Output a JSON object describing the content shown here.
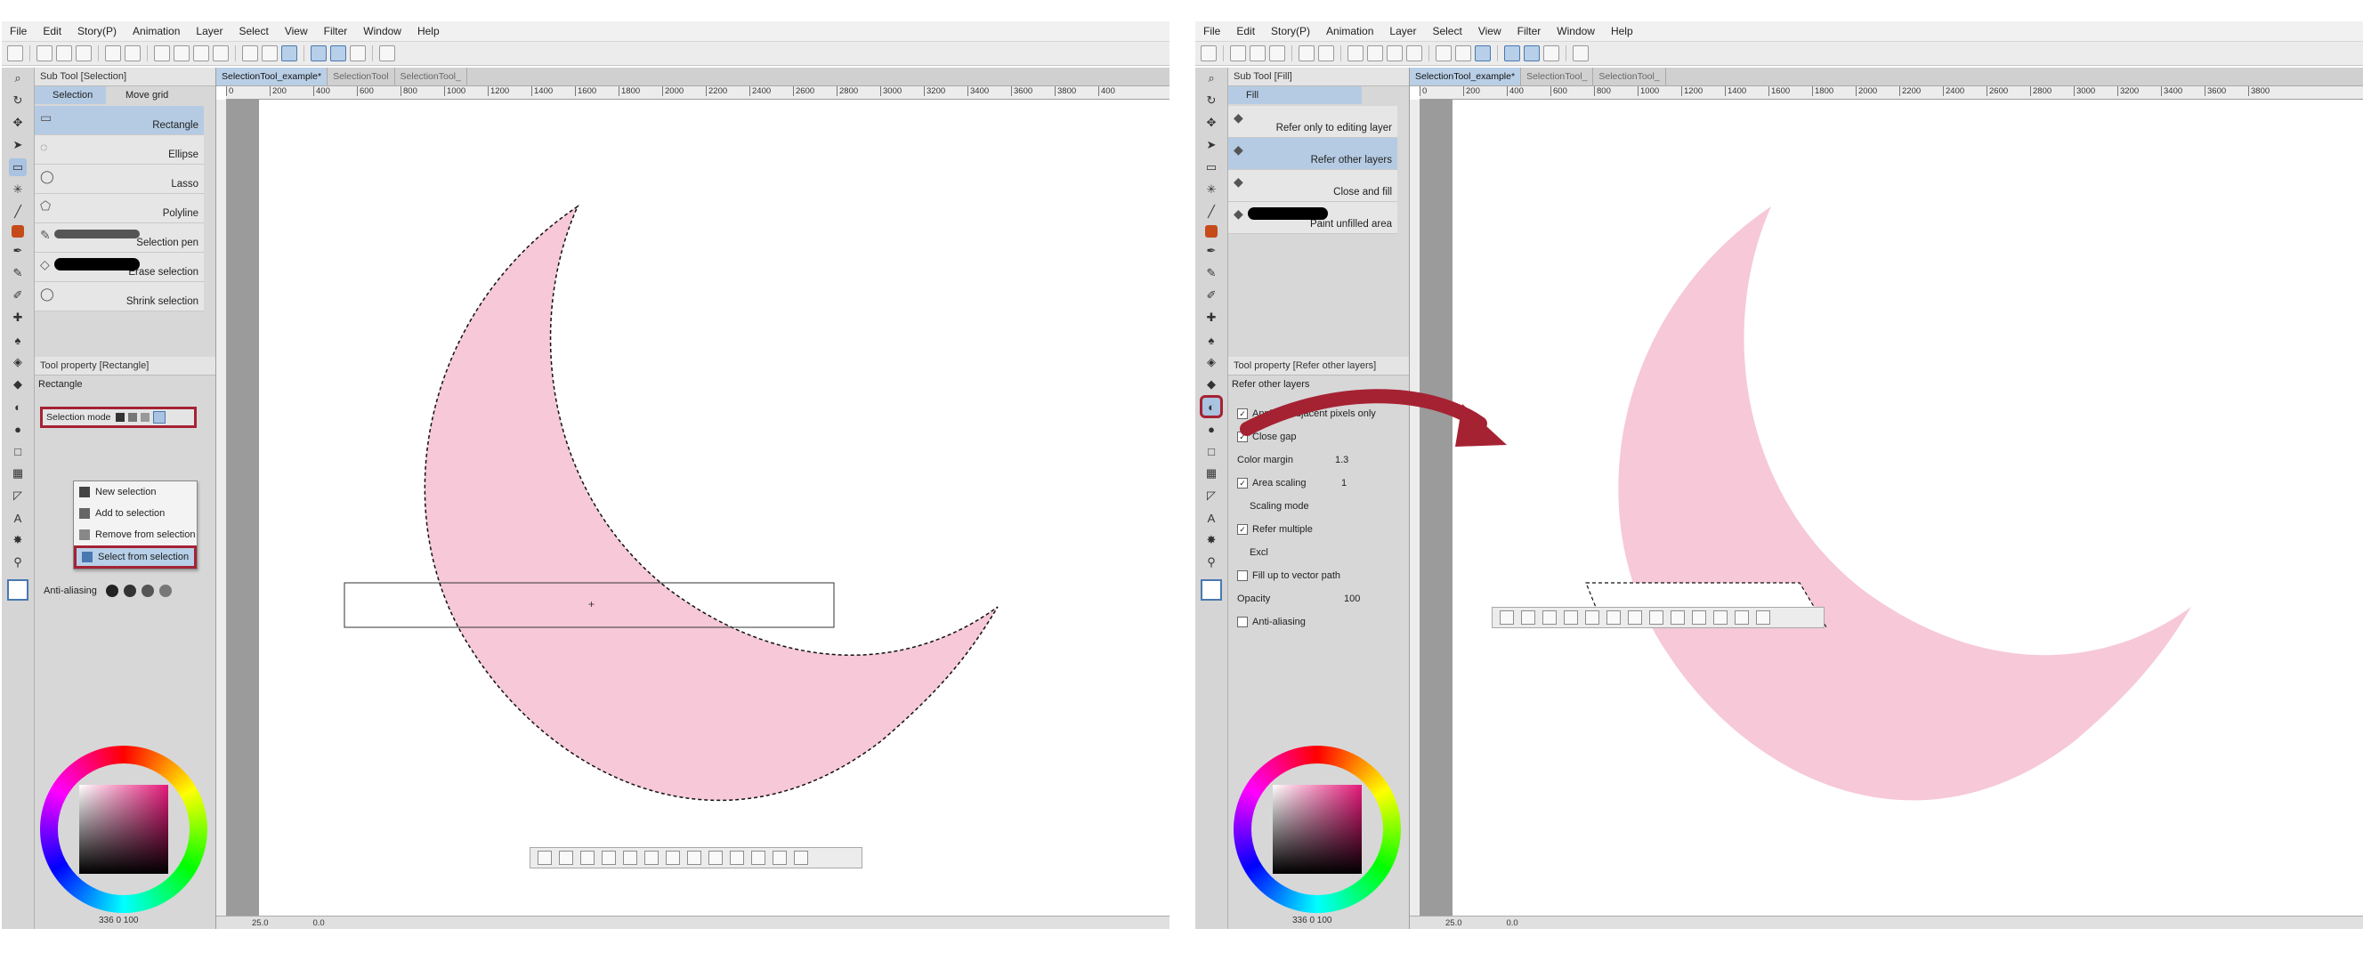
{
  "menu": [
    "File",
    "Edit",
    "Story(P)",
    "Animation",
    "Layer",
    "Select",
    "View",
    "Filter",
    "Window",
    "Help"
  ],
  "accent": "#a52233",
  "moon_color": "#f6c8d8",
  "left": {
    "subtool_panel_title": "Sub Tool [Selection]",
    "subtool_tabs": [
      "Selection",
      "Move grid"
    ],
    "subtools": [
      "Rectangle",
      "Ellipse",
      "Lasso",
      "Polyline",
      "Selection pen",
      "Erase selection",
      "Shrink selection"
    ],
    "tool_property_title": "Tool property [Rectangle]",
    "tool_property_name": "Rectangle",
    "selection_mode_label": "Selection mode",
    "selection_modes": [
      "New selection",
      "Add to selection",
      "Remove from selection",
      "Select from selection"
    ],
    "anti_aliasing_label": "Anti-aliasing",
    "tabs": [
      "SelectionTool_example*",
      "SelectionTool",
      "SelectionTool_"
    ],
    "ruler_ticks": [
      "0",
      "200",
      "400",
      "600",
      "800",
      "1000",
      "1200",
      "1400",
      "1600",
      "1800",
      "2000",
      "2200",
      "2400",
      "2600",
      "2800",
      "3000",
      "3200",
      "3400",
      "3600",
      "3800",
      "400"
    ],
    "zoom": "25.0",
    "angle": "0.0",
    "status": "336  0  100"
  },
  "right": {
    "subtool_panel_title": "Sub Tool [Fill]",
    "subtools": [
      "Fill",
      "Refer only to editing layer",
      "Refer other layers",
      "Close and fill",
      "Paint unfilled area"
    ],
    "tool_property_title": "Tool property [Refer other layers]",
    "tool_property_name": "Refer other layers",
    "props": {
      "apply_adjacent": "Apply to adjacent pixels only",
      "close_gap": "Close gap",
      "color_margin": "Color margin",
      "color_margin_value": "1.3",
      "area_scaling": "Area scaling",
      "area_scaling_value": "1",
      "scaling_mode": "Scaling mode",
      "refer_multiple": "Refer multiple",
      "exclude": "Excl",
      "fill_vector": "Fill up to vector path",
      "opacity": "Opacity",
      "opacity_value": "100",
      "anti_aliasing": "Anti-aliasing"
    },
    "tabs": [
      "SelectionTool_example*",
      "SelectionTool_",
      "SelectionTool_"
    ],
    "ruler_ticks": [
      "0",
      "200",
      "400",
      "600",
      "800",
      "1000",
      "1200",
      "1400",
      "1600",
      "1800",
      "2000",
      "2200",
      "2400",
      "2600",
      "2800",
      "3000",
      "3200",
      "3400",
      "3600",
      "3800"
    ],
    "zoom": "25.0",
    "angle": "0.0",
    "status": "336  0  100"
  }
}
